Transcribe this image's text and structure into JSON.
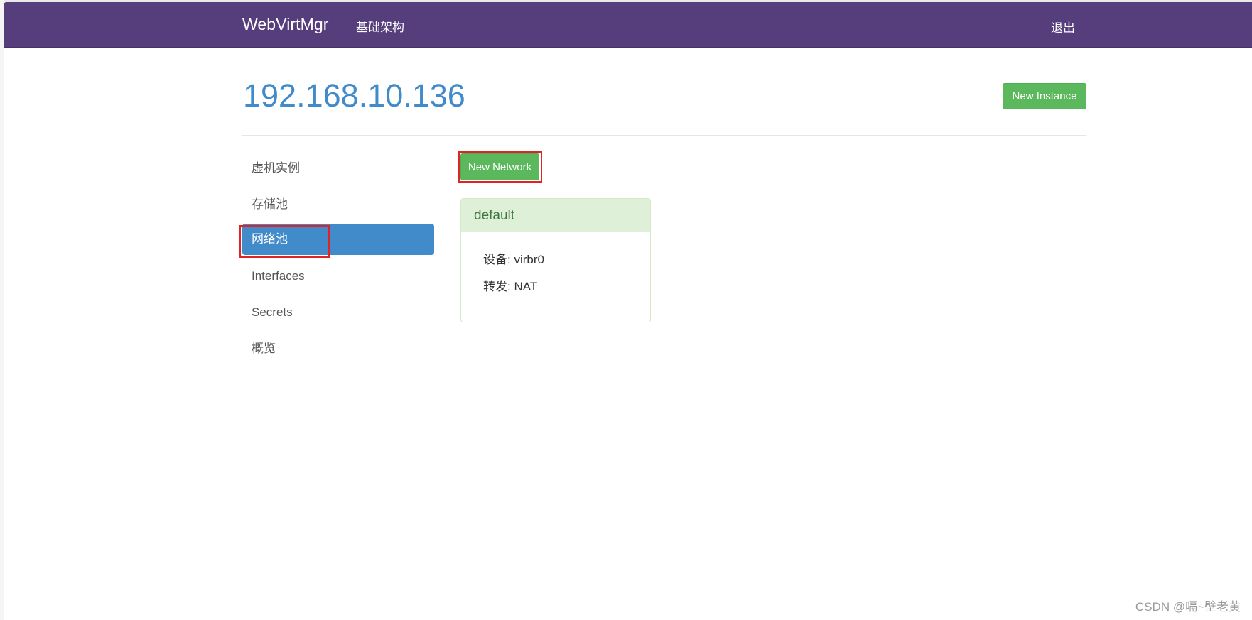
{
  "navbar": {
    "brand": "WebVirtMgr",
    "nav_link": "基础架构",
    "logout": "退出",
    "background_color": "#563d7c"
  },
  "header": {
    "host": "192.168.10.136",
    "new_instance_label": "New Instance"
  },
  "sidebar": {
    "active_index": 2,
    "items": [
      {
        "label": "虚机实例"
      },
      {
        "label": "存储池"
      },
      {
        "label": "网络池"
      },
      {
        "label": "Interfaces"
      },
      {
        "label": "Secrets"
      },
      {
        "label": "概览"
      }
    ]
  },
  "content": {
    "new_network_label": "New Network",
    "network": {
      "name": "default",
      "device_label": "设备:",
      "device_value": "virbr0",
      "forward_label": "转发:",
      "forward_value": "NAT"
    }
  },
  "watermark": "CSDN @嗝~壁老黄",
  "colors": {
    "accent_blue": "#428bca",
    "button_green": "#5cb85c",
    "panel_heading_bg": "#dff0d8",
    "panel_heading_text": "#3c763d",
    "highlight_red": "#e02424"
  }
}
